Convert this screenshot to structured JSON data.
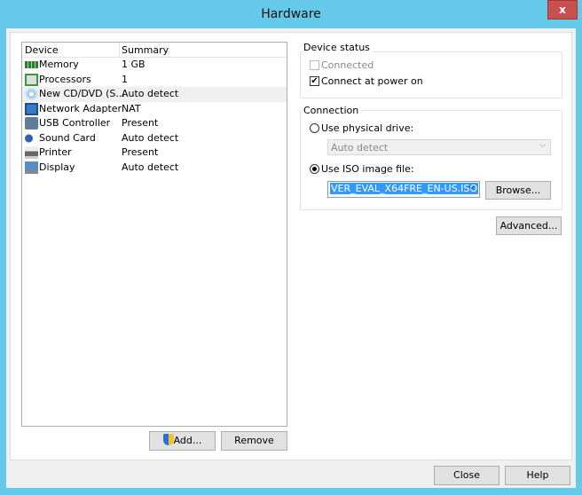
{
  "window": {
    "title": "Hardware",
    "close_glyph": "x"
  },
  "list": {
    "headers": [
      "Device",
      "Summary"
    ],
    "rows": [
      {
        "device": "Memory",
        "summary": "1 GB",
        "icon": "memory-icon"
      },
      {
        "device": "Processors",
        "summary": "1",
        "icon": "processor-icon"
      },
      {
        "device": "New CD/DVD (S...",
        "summary": "Auto detect",
        "icon": "cd-dvd-icon"
      },
      {
        "device": "Network Adapter",
        "summary": "NAT",
        "icon": "network-adapter-icon"
      },
      {
        "device": "USB Controller",
        "summary": "Present",
        "icon": "usb-icon"
      },
      {
        "device": "Sound Card",
        "summary": "Auto detect",
        "icon": "sound-icon"
      },
      {
        "device": "Printer",
        "summary": "Present",
        "icon": "printer-icon"
      },
      {
        "device": "Display",
        "summary": "Auto detect",
        "icon": "display-icon"
      }
    ],
    "selected": 2
  },
  "buttons": {
    "add": "Add...",
    "remove": "Remove",
    "advanced": "Advanced...",
    "browse": "Browse...",
    "close": "Close",
    "help": "Help"
  },
  "device_status": {
    "label": "Device status",
    "connected": "Connected",
    "connect_power_on": "Connect at power on"
  },
  "connection": {
    "label": "Connection",
    "physical": "Use physical drive:",
    "physical_value": "Auto detect",
    "iso": "Use ISO image file:",
    "iso_value": "VER_EVAL_X64FRE_EN-US.ISO"
  }
}
